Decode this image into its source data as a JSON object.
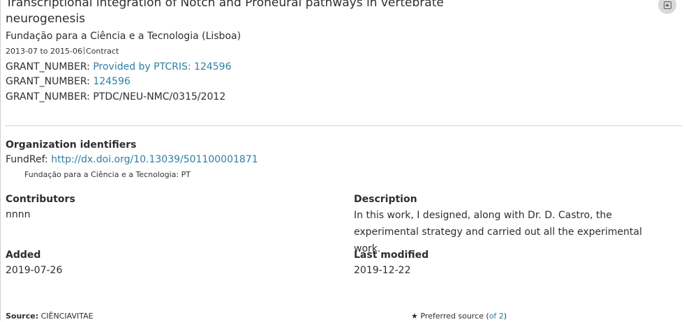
{
  "work": {
    "title": "Transcriptional integration of Notch and Proneural pathways in vertebrate neurogenesis",
    "funder": "Fundação para a Ciência e a Tecnologia (Lisboa)",
    "date_range": "2013-07 to 2015-06",
    "type": "Contract",
    "grants": [
      {
        "label": "GRANT_NUMBER: ",
        "value": "Provided by PTCRIS: 124596",
        "is_link": true
      },
      {
        "label": "GRANT_NUMBER: ",
        "value": "124596",
        "is_link": true
      },
      {
        "label": "GRANT_NUMBER: ",
        "value": "PTDC/NEU-NMC/0315/2012",
        "is_link": false
      }
    ]
  },
  "collapse_icon": "collapse-square-icon",
  "org_identifiers": {
    "heading": "Organization identifiers",
    "fundref_label": "FundRef: ",
    "fundref_link": "http://dx.doi.org/10.13039/501100001871",
    "fundref_note": "Fundação para a Ciência e a Tecnologia: PT"
  },
  "contributors": {
    "heading": "Contributors",
    "value": "nnnn"
  },
  "description": {
    "heading": "Description",
    "value": "In this work, I designed, along with Dr. D. Castro, the experimental strategy and carried out all the experimental work."
  },
  "added": {
    "heading": "Added",
    "value": "2019-07-26"
  },
  "last_modified": {
    "heading": "Last modified",
    "value": "2019-12-22"
  },
  "source": {
    "label": "Source:",
    "value": " CIÊNCIAVITAE"
  },
  "preferred": {
    "star": "★",
    "text": " Preferred source (",
    "count_link": "of 2",
    "close": ")"
  },
  "colors": {
    "link": "#2e7fa3",
    "text": "#2e2e2e",
    "button_bg": "#d9d9d9"
  }
}
